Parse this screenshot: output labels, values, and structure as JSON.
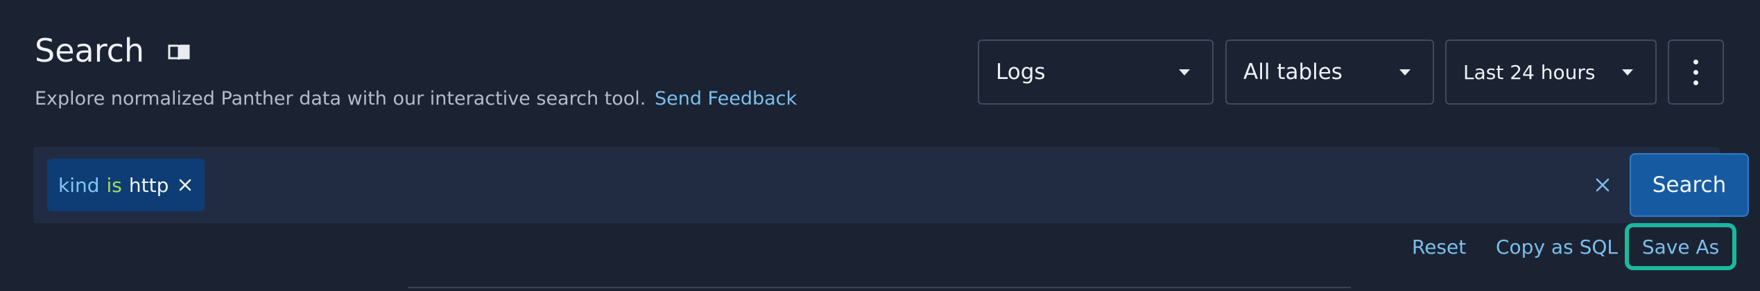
{
  "header": {
    "title": "Search",
    "title_icon": "book-open-icon",
    "subtitle": "Explore normalized Panther data with our interactive search tool.",
    "feedback_link": "Send Feedback"
  },
  "filters": {
    "source": {
      "selected": "Logs",
      "icon": "chevron-down-icon"
    },
    "tables": {
      "selected": "All tables",
      "icon": "chevron-down-icon"
    },
    "time_range": {
      "selected": "Last 24 hours",
      "icon": "chevron-down-icon"
    },
    "more_icon": "kebab-menu-icon"
  },
  "query": {
    "chips": [
      {
        "field": "kind",
        "operator": "is",
        "value": "http",
        "remove_icon": "close-icon"
      }
    ],
    "clear_icon": "close-icon",
    "search_button": "Search"
  },
  "actions": {
    "reset": "Reset",
    "copy_sql": "Copy as SQL",
    "save_as": "Save As"
  },
  "colors": {
    "background": "#1b2332",
    "search_bar": "#212c43",
    "chip": "#0d3d74",
    "accent_link": "#7bbfee",
    "primary_button": "#165ba2",
    "highlight": "#1bb8a0"
  }
}
